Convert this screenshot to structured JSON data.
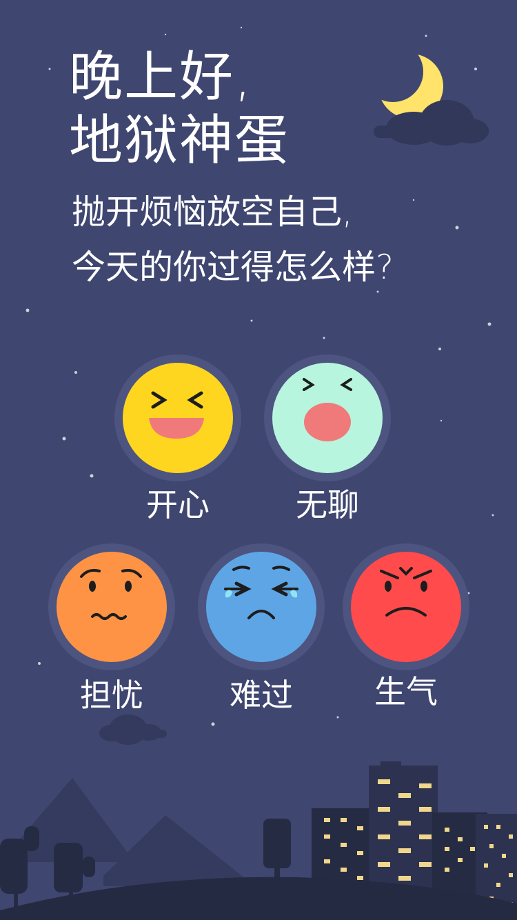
{
  "greeting": {
    "line1": "晚上好,",
    "line2": "地狱神蛋"
  },
  "prompt": {
    "line1": "抛开烦恼放空自己,",
    "line2": "今天的你过得怎么样?"
  },
  "moods": [
    {
      "label": "开心",
      "icon": "happy-face-icon",
      "color": "#ffd61f"
    },
    {
      "label": "无聊",
      "icon": "bored-face-icon",
      "color": "#b8f5de"
    },
    {
      "label": "担忧",
      "icon": "worried-face-icon",
      "color": "#ff9345"
    },
    {
      "label": "难过",
      "icon": "sad-face-icon",
      "color": "#5ea5e6"
    },
    {
      "label": "生气",
      "icon": "angry-face-icon",
      "color": "#ff4b4b"
    }
  ],
  "theme": {
    "background": "#3f4670",
    "moon": "#ffe36a",
    "skyline": "#272c47"
  }
}
